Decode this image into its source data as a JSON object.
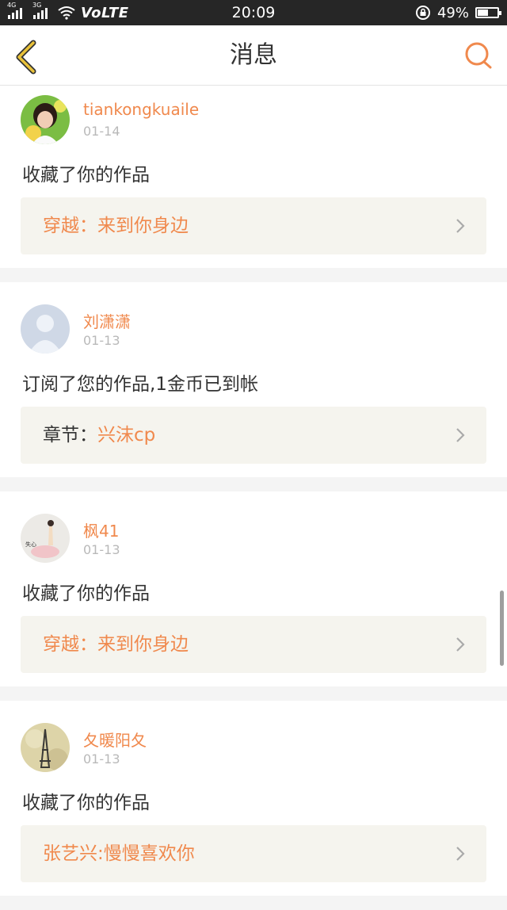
{
  "status_bar": {
    "network_1": "4G",
    "network_2": "3G",
    "volte": "VoLTE",
    "time": "20:09",
    "battery_percent": "49%",
    "battery_level": 0.49
  },
  "header": {
    "title": "消息",
    "back_icon": "chevron-left-icon",
    "search_icon": "search-icon"
  },
  "messages": [
    {
      "user": "tiankongkuaile",
      "date": "01-14",
      "action": "收藏了你的作品",
      "work_prefix": "",
      "work_title": "穿越：来到你身边"
    },
    {
      "user": "刘潇潇",
      "date": "01-13",
      "action": "订阅了您的作品,1金币已到帐",
      "work_prefix": "章节：",
      "work_title": "兴沫cp"
    },
    {
      "user": "枫41",
      "date": "01-13",
      "action": "收藏了你的作品",
      "work_prefix": "",
      "work_title": "穿越：来到你身边",
      "avatar_text": "失心"
    },
    {
      "user": "夂暖阳夂",
      "date": "01-13",
      "action": "收藏了你的作品",
      "work_prefix": "",
      "work_title": "张艺兴:慢慢喜欢你"
    }
  ],
  "colors": {
    "accent": "#f0894d",
    "back_arrow": "#e9c23a",
    "status_bar": "#262626",
    "work_box": "#f5f4ee"
  }
}
